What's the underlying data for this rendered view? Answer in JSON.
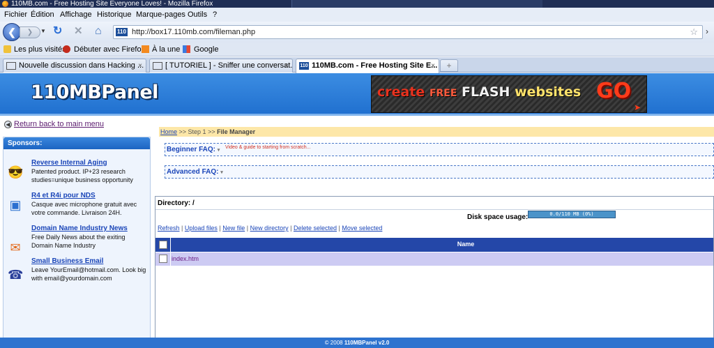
{
  "window": {
    "title": "110MB.com - Free Hosting Site Everyone Loves! - Mozilla Firefox"
  },
  "menu": {
    "items": [
      "Fichier",
      "Édition",
      "Affichage",
      "Historique",
      "Marque-pages",
      "Outils",
      "?"
    ]
  },
  "nav": {
    "url": "http://box17.110mb.com/fileman.php",
    "favicon_text": "110"
  },
  "bookmarks": {
    "items": [
      "Les plus visités",
      "Débuter avec Firefox",
      "À la une",
      "Google"
    ]
  },
  "tabs": [
    {
      "label": "Nouvelle discussion dans Hacking ...",
      "close": "×"
    },
    {
      "label": "[ TUTORIEL ] - Sniffer une conversat...",
      "close": "×"
    },
    {
      "label": "110MB.com - Free Hosting Site E...",
      "close": "×",
      "icon_text": "110"
    }
  ],
  "tab_new_label": "+",
  "header": {
    "logo": "110MBPanel",
    "ad": {
      "create": "create",
      "free": "FREE",
      "flash": "FLASH",
      "websites": "websites",
      "go": "GO"
    }
  },
  "sidebar": {
    "back_link": "Return back to main menu",
    "sponsors_title": "Sponsors:",
    "sponsors": [
      {
        "title": "Reverse Internal Aging",
        "desc": "Patented product. IP+23 research studies=unique business opportunity",
        "icon": "smiley-sunglasses-icon",
        "glyph": "😎"
      },
      {
        "title": "R4 et R4i pour NDS",
        "desc": "Casque avec microphone gratuit avec votre commande. Livraison 24H.",
        "icon": "cubes-icon",
        "glyph": "▣"
      },
      {
        "title": "Domain Name Industry News",
        "desc": "Free Daily News about the exiting Domain Name Industry",
        "icon": "newsletter-icon",
        "glyph": "✉"
      },
      {
        "title": "Small Business Email",
        "desc": "Leave YourEmail@hotmail.com. Look big with email@yourdomain.com",
        "icon": "telephone-icon",
        "glyph": "☎"
      }
    ]
  },
  "main": {
    "breadcrumb": {
      "home": "Home",
      "sep1": " >> ",
      "step": "Step 1",
      "sep2": " >> ",
      "current": "File Manager"
    },
    "faq": {
      "beginner_label": "Beginner FAQ:",
      "beginner_note": "Video & guide to starting from scratch...",
      "advanced_label": "Advanced FAQ:",
      "caret": "▾"
    },
    "file_manager": {
      "directory_label": "Directory: /",
      "disk_label": "Disk space usage:",
      "disk_text": "0.0/110 MB (0%)",
      "disk_used_fraction": 0.0,
      "actions": [
        "Refresh",
        "Upload files",
        "New file",
        "New directory",
        "Delete selected",
        "Move selected"
      ],
      "action_sep": " | ",
      "column_name": "Name",
      "files": [
        {
          "name": "index.htm"
        }
      ]
    }
  },
  "footer": {
    "copyright": "© 2008 ",
    "brand": "110MBPanel v2.0"
  },
  "colors": {
    "header_blue": "#2f7edb",
    "table_header": "#2447a8",
    "row_highlight": "#cdcbf3",
    "link_blue": "#1a45b8",
    "breadcrumb_bg": "#fde7a8"
  }
}
